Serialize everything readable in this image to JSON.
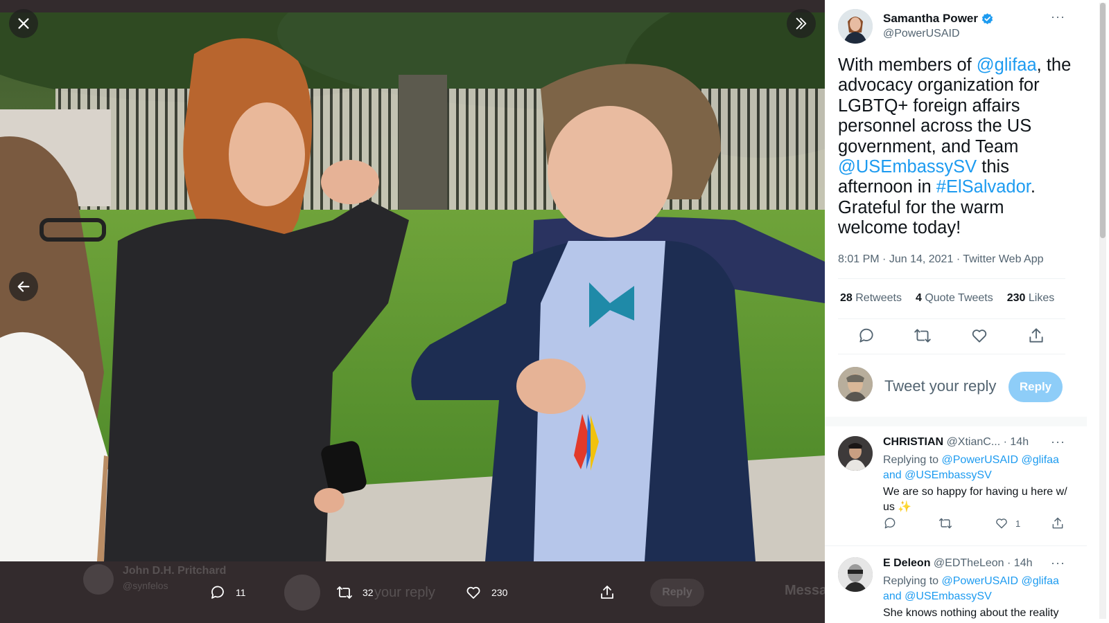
{
  "viewer": {
    "close_icon": "close-icon",
    "next_icon": "double-chevron-right-icon",
    "prev_icon": "arrow-left-icon",
    "actions": [
      {
        "name": "reply-action",
        "icon": "comment-icon",
        "count": "11"
      },
      {
        "name": "retweet-action",
        "icon": "retweet-icon",
        "count": "32"
      },
      {
        "name": "like-action",
        "icon": "heart-icon",
        "count": "230"
      },
      {
        "name": "share-action",
        "icon": "share-icon",
        "count": ""
      }
    ],
    "background_ghost": {
      "name": "John D.H. Pritchard",
      "handle": "@synfelos",
      "reply_placeholder": "your reply",
      "reply_button": "Reply",
      "messages": "Messa"
    }
  },
  "tweet": {
    "author_name": "Samantha Power",
    "author_handle": "@PowerUSAID",
    "verified": true,
    "text_segments": [
      {
        "t": "With members of ",
        "link": false
      },
      {
        "t": "@glifaa",
        "link": true
      },
      {
        "t": ", the advocacy organization for LGBTQ+ foreign affairs personnel across the US government, and Team ",
        "link": false
      },
      {
        "t": "@USEmbassySV",
        "link": true
      },
      {
        "t": " this afternoon in ",
        "link": false
      },
      {
        "t": "#ElSalvador",
        "link": true
      },
      {
        "t": ". Grateful for the warm welcome today!",
        "link": false
      }
    ],
    "time": "8:01 PM",
    "date": "Jun 14, 2021",
    "source": "Twitter Web App",
    "retweets": "28",
    "retweets_label": "Retweets",
    "quote_tweets": "4",
    "quote_tweets_label": "Quote Tweets",
    "likes": "230",
    "likes_label": "Likes"
  },
  "compose": {
    "placeholder": "Tweet your reply",
    "button": "Reply"
  },
  "replies": [
    {
      "name": "CHRISTIAN",
      "handle": "@XtianC...",
      "age": "14h",
      "replying_prefix": "Replying to",
      "replying_to_1": "@PowerUSAID",
      "replying_to_2": "@glifaa",
      "replying_and": "and",
      "replying_to_3": "@USEmbassySV",
      "text": "We are so happy for having u here w/ us ✨",
      "likes": "1"
    },
    {
      "name": "E Deleon",
      "handle": "@EDTheLeon",
      "age": "14h",
      "replying_prefix": "Replying to",
      "replying_to_1": "@PowerUSAID",
      "replying_to_2": "@glifaa",
      "replying_and": "and",
      "replying_to_3": "@USEmbassySV",
      "text": "She knows nothing about the reality",
      "likes": ""
    }
  ],
  "colors": {
    "accent": "#1d9bf0",
    "reply_button_disabled": "#8ecdf8",
    "viewer_background": "#332b2d"
  }
}
